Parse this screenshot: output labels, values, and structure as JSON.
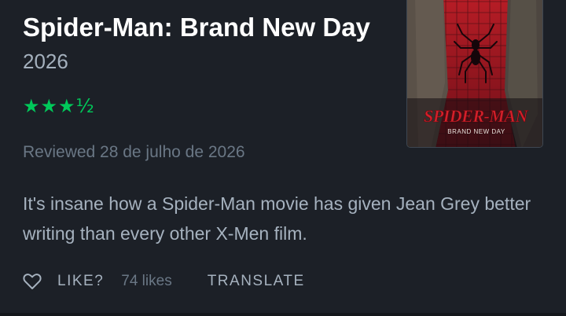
{
  "review": {
    "film_title": "Spider-Man: Brand New Day",
    "year": "2026",
    "rating": 3.5,
    "rating_stars": "★★★½",
    "reviewed_label": "Reviewed 28 de julho de 2026",
    "text": "It's insane how a Spider-Man movie has given Jean Grey better writing than every other X-Men film."
  },
  "poster": {
    "logo_text": "SPIDER-MAN",
    "tagline": "BRAND NEW DAY"
  },
  "actions": {
    "heart_icon": "heart-outline-icon",
    "like_label": "LIKE?",
    "likes_count": "74 likes",
    "translate_label": "TRANSLATE"
  },
  "colors": {
    "background": "#1c2027",
    "star_green": "#00c95a",
    "text_primary": "#ffffff",
    "text_secondary": "#a6b2bf",
    "text_muted": "#6a7785"
  }
}
